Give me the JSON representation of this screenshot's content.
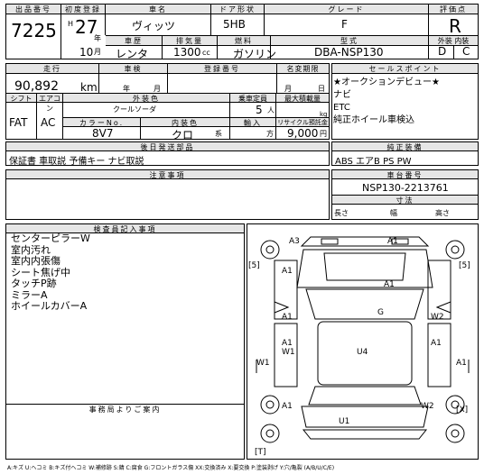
{
  "sheet": {
    "lot_label": "出品番号",
    "lot": "7225",
    "first_reg_label": "初度登録",
    "era": "H",
    "year": "27",
    "year_unit": "年",
    "month": "10",
    "month_unit": "月",
    "car_name_label": "車名",
    "car_name": "ヴィッツ",
    "door_label": "ドア形状",
    "door": "5HB",
    "grade_label": "グレード",
    "grade": "F",
    "score_label": "評価点",
    "score": "R",
    "history_label": "車歴",
    "history": "レンタ",
    "displacement_label": "排気量",
    "displacement": "1300",
    "displacement_unit": "cc",
    "fuel_label": "燃料",
    "fuel": "ガソリン",
    "model_label": "型式",
    "model": "DBA-NSP130",
    "exterior_interior_label": "外装 内装",
    "exterior_grade": "D",
    "interior_grade": "C",
    "mileage_label": "走行",
    "mileage": "90,892",
    "mileage_unit": "km",
    "inspection_label": "車検",
    "inspection_year_unit": "年",
    "inspection_month_unit": "月",
    "reg_no_label": "登録番号",
    "title_deadline_label": "名変期限",
    "deadline_month_unit": "月",
    "deadline_day_unit": "日",
    "selling_points_label": "セールスポイント",
    "selling_points": [
      "★オークションデビュー★",
      "ナビ",
      "ETC",
      "純正ホイール車検込"
    ],
    "shift_label": "シフト",
    "shift": "FAT",
    "aircon_label": "エアコン",
    "aircon": "AC",
    "ext_color_label": "外装色",
    "ext_color": "クールソーダ",
    "capacity_label": "乗車定員",
    "capacity": "5",
    "capacity_unit": "人",
    "max_load_label": "最大積載量",
    "max_load_unit": "kg",
    "color_no_label": "カラーNo.",
    "color_no": "8V7",
    "int_color_label": "内装色",
    "int_color": "クロ",
    "int_color_unit": "系",
    "import_label": "輸入",
    "import_unit": "方",
    "recycle_label": "リサイクル預託金",
    "recycle": "9,000",
    "recycle_unit": "円",
    "aftermarket_label": "後日発送部品",
    "aftermarket": "保証書 車取説 予備キー ナビ取説",
    "equipment_label": "純正装備",
    "equipment": "ABS エアB PS PW",
    "notes_label": "注意事項",
    "chassis_label": "車台番号",
    "chassis": "NSP130-2213761",
    "dims_label": "寸法",
    "length_label": "長さ",
    "width_label": "幅",
    "height_label": "高さ",
    "inspector_label": "検査員記入事項",
    "inspector_notes": [
      "センターピラーW",
      "室内汚れ",
      "室内内張傷",
      "シート焦げ中",
      "タッチP跡",
      "ミラーA",
      "ホイールカバーA"
    ],
    "office_label": "事務局よりご案内",
    "legend": "A:キズ U:ヘコミ B:キズ付ヘコミ W:補修跡 S:錆 C:腐食 G:フロントガラス傷 XX:交換済み X:要交換 P:塗装剥げ Y:穴/亀裂 (A/B/U/C/E)"
  },
  "diagram": {
    "marks": [
      "A3",
      "A1",
      "[5]",
      "[5]",
      "A1",
      "A1",
      "G",
      "A1",
      "W2",
      "A1",
      "W1",
      "U4",
      "W1",
      "A1",
      "A1",
      "W2",
      "[X]",
      "U1",
      "A1",
      "[T]"
    ]
  }
}
